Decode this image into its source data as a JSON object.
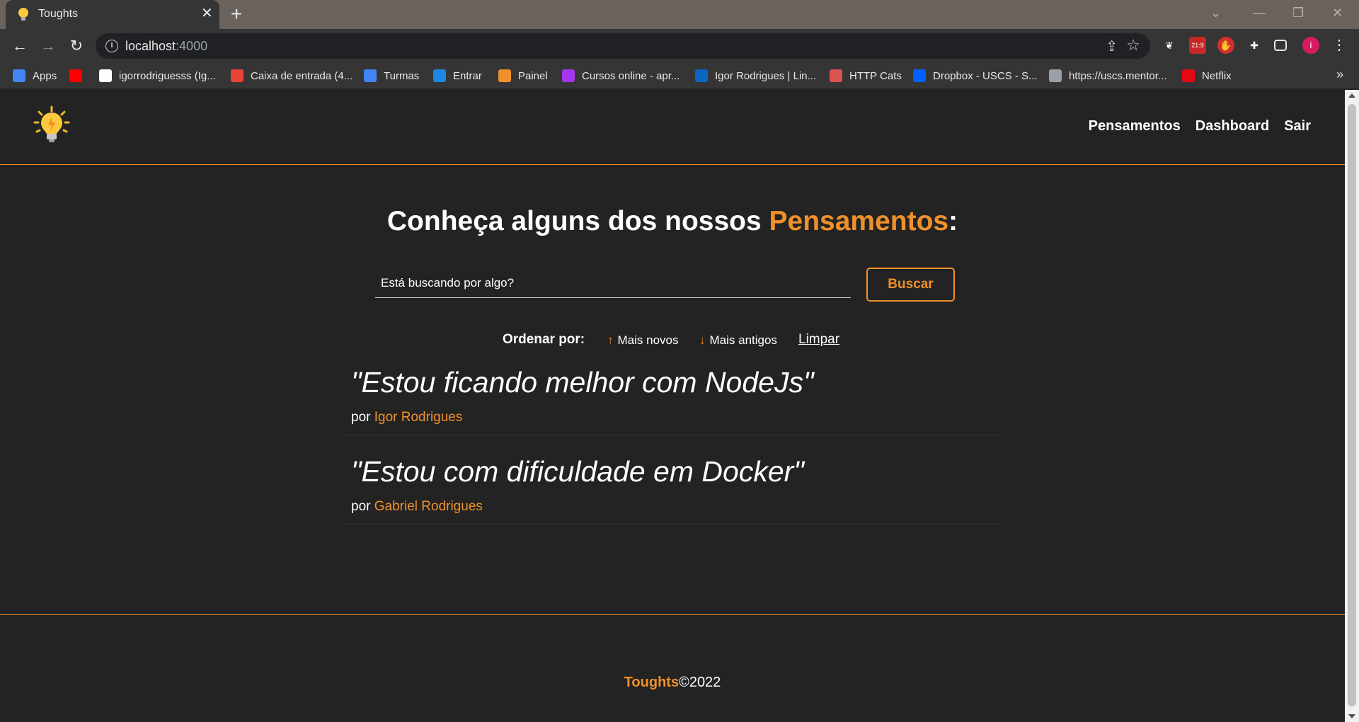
{
  "browser": {
    "tab_title": "Toughts",
    "url_host": "localhost",
    "url_port": ":4000",
    "bookmarks": [
      {
        "label": "Apps",
        "icon": "apps-grid-icon",
        "color": "#4285f4"
      },
      {
        "label": "",
        "icon": "youtube-icon",
        "color": "#ff0000"
      },
      {
        "label": "igorrodriguesss (Ig...",
        "icon": "github-icon",
        "color": "#ffffff"
      },
      {
        "label": "Caixa de entrada (4...",
        "icon": "gmail-icon",
        "color": "#ea4335"
      },
      {
        "label": "Turmas",
        "icon": "google-icon",
        "color": "#4285f4"
      },
      {
        "label": "Entrar",
        "icon": "uscs-icon",
        "color": "#1e88e5"
      },
      {
        "label": "Painel",
        "icon": "painel-icon",
        "color": "#f0902a"
      },
      {
        "label": "Cursos online - apr...",
        "icon": "udemy-icon",
        "color": "#a435f0"
      },
      {
        "label": "Igor Rodrigues | Lin...",
        "icon": "linkedin-icon",
        "color": "#0a66c2"
      },
      {
        "label": "HTTP Cats",
        "icon": "http-cats-icon",
        "color": "#d9534f"
      },
      {
        "label": "Dropbox - USCS - S...",
        "icon": "dropbox-icon",
        "color": "#0061ff"
      },
      {
        "label": "https://uscs.mentor...",
        "icon": "globe-icon",
        "color": "#9aa0a6"
      },
      {
        "label": "Netflix",
        "icon": "netflix-icon",
        "color": "#e50914"
      }
    ]
  },
  "nav": {
    "links": [
      "Pensamentos",
      "Dashboard",
      "Sair"
    ]
  },
  "main": {
    "heading_prefix": "Conheça alguns dos nossos ",
    "heading_accent": "Pensamentos",
    "heading_suffix": ":",
    "search_placeholder": "Está buscando por algo?",
    "search_button": "Buscar",
    "order_label": "Ordenar por:",
    "order_newest": "Mais novos",
    "order_oldest": "Mais antigos",
    "order_clear": "Limpar"
  },
  "toughts": [
    {
      "quote": "\"Estou ficando melhor com NodeJs\"",
      "by": "por",
      "author": "Igor Rodrigues"
    },
    {
      "quote": "\"Estou com dificuldade em Docker\"",
      "by": "por",
      "author": "Gabriel Rodrigues"
    }
  ],
  "footer": {
    "brand": "Toughts",
    "copyright": "©2022"
  },
  "colors": {
    "accent": "#f0902a",
    "background": "#232323"
  }
}
